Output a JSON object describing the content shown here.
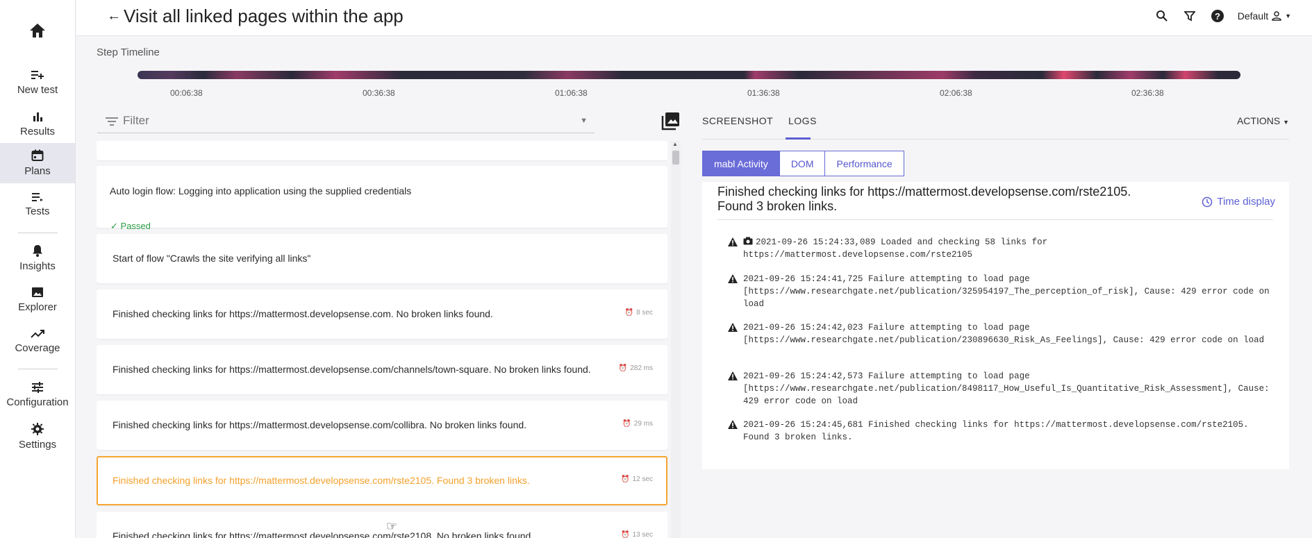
{
  "sidebar": {
    "home_label": "",
    "items": [
      {
        "label": "New test",
        "icon": "playlist-add-icon"
      },
      {
        "label": "Results",
        "icon": "bar-chart-icon"
      },
      {
        "label": "Plans",
        "icon": "calendar-icon",
        "active": true
      },
      {
        "label": "Tests",
        "icon": "list-icon"
      },
      {
        "label": "Insights",
        "icon": "bell-icon"
      },
      {
        "label": "Explorer",
        "icon": "image-icon"
      },
      {
        "label": "Coverage",
        "icon": "trend-icon"
      },
      {
        "label": "Configuration",
        "icon": "sliders-icon"
      },
      {
        "label": "Settings",
        "icon": "gear-icon"
      }
    ]
  },
  "header": {
    "title": "Visit all linked pages within the app",
    "workspace": "Default"
  },
  "timeline": {
    "label": "Step Timeline",
    "ticks": [
      "00:06:38",
      "00:36:38",
      "01:06:38",
      "01:36:38",
      "02:06:38",
      "02:36:38"
    ]
  },
  "filter": {
    "placeholder": "Filter"
  },
  "steps": [
    {
      "text": "Auto login flow: Logging into application using the supplied credentials",
      "status": "Passed"
    },
    {
      "text": "Start of flow \"Crawls the site verifying all links\""
    },
    {
      "text": "Finished checking links for https://mattermost.developsense.com. No broken links found.",
      "duration": "8 sec"
    },
    {
      "text": "Finished checking links for https://mattermost.developsense.com/channels/town-square. No broken links found.",
      "duration": "282 ms"
    },
    {
      "text": "Finished checking links for https://mattermost.developsense.com/collibra. No broken links found.",
      "duration": "29 ms"
    },
    {
      "text": "Finished checking links for https://mattermost.developsense.com/rste2105. Found 3 broken links.",
      "duration": "12 sec"
    },
    {
      "text": "Finished checking links for https://mattermost.developsense.com/rste2108. No broken links found.",
      "duration": "13 sec"
    }
  ],
  "right_tabs": {
    "screenshot": "SCREENSHOT",
    "logs": "LOGS",
    "actions": "ACTIONS"
  },
  "log_tabs": [
    "mabl Activity",
    "DOM",
    "Performance"
  ],
  "log": {
    "heading": "Finished checking links for https://mattermost.developsense.com/rste2105. Found 3 broken links.",
    "time_display": "Time display",
    "entries": [
      "2021-09-26 15:24:33,089 Loaded and checking 58 links for https://mattermost.developsense.com/rste2105",
      "2021-09-26 15:24:41,725 Failure attempting to load page [https://www.researchgate.net/publication/325954197_The_perception_of_risk], Cause: 429 error code on load",
      "2021-09-26 15:24:42,023 Failure attempting to load page [https://www.researchgate.net/publication/230896630_Risk_As_Feelings], Cause: 429 error code on load",
      "2021-09-26 15:24:42,573 Failure attempting to load page [https://www.researchgate.net/publication/8498117_How_Useful_Is_Quantitative_Risk_Assessment], Cause: 429 error code on load",
      "2021-09-26 15:24:45,681 Finished checking links for https://mattermost.developsense.com/rste2105. Found 3 broken links."
    ]
  },
  "colors": {
    "accent": "#5b5ed4",
    "selected": "#f6a531",
    "passed": "#2c9e46"
  }
}
